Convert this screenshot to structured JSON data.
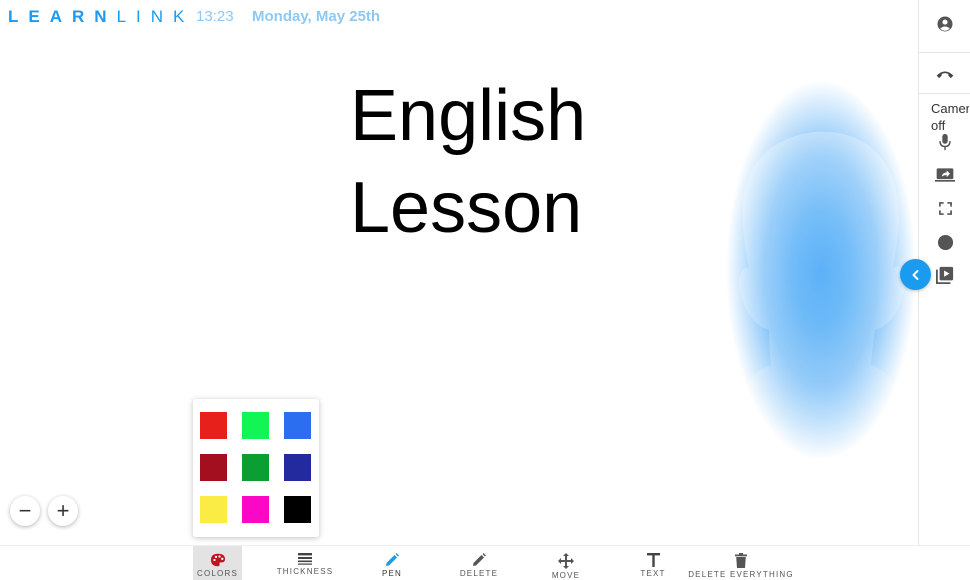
{
  "header": {
    "logo_learn": "LEARN",
    "logo_link": "LINK",
    "time": "13:23",
    "date": "Monday, May 25th"
  },
  "board": {
    "title_line1": "English",
    "title_line2": "Lesson"
  },
  "right_rail": {
    "camera_label": "Camera off",
    "icons": [
      "account-icon",
      "hang-up-icon",
      "microphone-icon",
      "screen-share-icon",
      "fullscreen-icon",
      "record-icon",
      "video-library-icon"
    ]
  },
  "palette": {
    "colors": [
      "#e8201b",
      "#12f554",
      "#2b6ff0",
      "#a30f1e",
      "#0a9e33",
      "#232a9e",
      "#fbeb45",
      "#fa08c6",
      "#000000"
    ]
  },
  "zoom": {
    "out_label": "−",
    "in_label": "+"
  },
  "toolbar": {
    "colors_label": "COLORS",
    "thickness_label": "THICKNESS",
    "pen_label": "PEN",
    "delete_label": "DELETE",
    "move_label": "MOVE",
    "text_label": "TEXT",
    "delete_everything_label": "DELETE EVERYTHING",
    "active_tool": "colors",
    "accent_color": "#1a9bf0",
    "colors_icon_color": "#c0121f"
  }
}
